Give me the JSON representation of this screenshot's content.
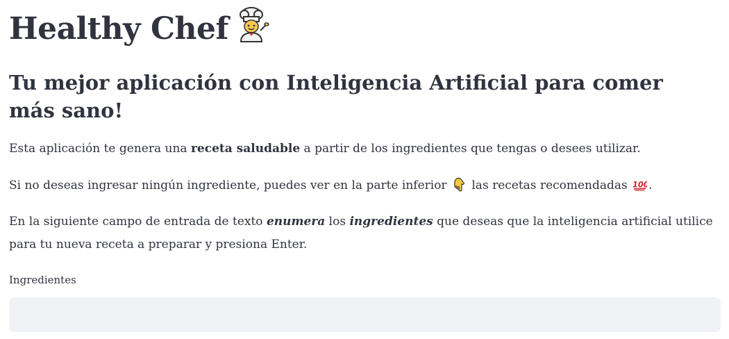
{
  "header": {
    "title": "Healthy Chef",
    "title_icon": "chef-emoji-icon"
  },
  "subtitle": "Tu mejor aplicación con Inteligencia Artificial para comer más sano!",
  "paragraph1": {
    "pre": "Esta aplicación te genera una ",
    "bold": "receta saludable",
    "post": " a partir de los ingredientes que tengas o desees utilizar."
  },
  "paragraph2": {
    "pre": "Si no deseas ingresar ningún ingrediente, puedes ver en la parte inferior ",
    "icon1": "pointing-down-hand-icon",
    "mid": " las recetas recomendadas ",
    "icon2": "hundred-points-icon",
    "post": "."
  },
  "paragraph3": {
    "pre": "En la siguiente campo de entrada de texto ",
    "italic1": "enumera",
    "mid": " los ",
    "italic2": "ingredientes",
    "post": " que deseas que la inteligencia artificial utilice para tu nueva receta a preparar y presiona Enter."
  },
  "input": {
    "label": "Ingredientes",
    "value": "",
    "placeholder": ""
  },
  "colors": {
    "text": "#31333f",
    "input_background": "#f0f2f6",
    "emoji_hand": "#f7c843",
    "emoji_hundred": "#d8232a"
  }
}
